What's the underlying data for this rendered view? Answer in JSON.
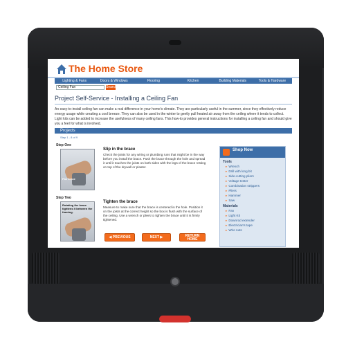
{
  "site": {
    "title": "The Home Store",
    "nav": [
      "Lighting & Fans",
      "Doors & Windows",
      "Flooring",
      "Kitchen",
      "Building Materials",
      "Tools & Hardware"
    ],
    "search_value": "Ceiling Fan",
    "search_button": "Search"
  },
  "page": {
    "title": "Project Self-Service  - Installing a Ceiling Fan",
    "intro": "An easy-to-install ceiling fan can make a real difference in your home's climate. They are particularly useful in the summer, since they effectively reduce energy usage while creating a cool breeze. They can also be used in the winter to gently pull heated air away from the ceiling where it tends to collect. Light kits can be added to increase the usefulness of many ceiling fans. This how-to provides general instructions for installing a ceiling fan and should give you a feel for what is involved.",
    "projects_label": "Projects",
    "step_count": "Step 1 - 8 of 9"
  },
  "steps": [
    {
      "label": "Step One",
      "caption": "Fan brace",
      "heading": "Slip in the brace",
      "text": "Check the joists for any wiring or plumbing runs that might be in the way before you install the brace. Push the brace through the hole and spread it until it touches the joists on both sides with the legs of the brace resting on top of the drywall or plaster."
    },
    {
      "label": "Step Two",
      "caption": "Rotating the brace tightens it between the framing.",
      "heading": "Tighten the brace",
      "text": "Measure to make sure that the brace is centered in the hole. Position it on the joists at the correct height so the box is flush with the surface of the ceiling. Use a wrench or pliers to tighten the brace until it is firmly tightened."
    }
  ],
  "buttons": {
    "previous": "PREVIOUS",
    "next": "NEXT",
    "return_home": "RETURN HOME"
  },
  "shop": {
    "title": "Shop Now",
    "tools_label": "Tools",
    "tools": [
      "Wrench",
      "Drill with long bit",
      "Side-cutting pliers",
      "Voltage tester",
      "Combination strippers",
      "Pliers",
      "Hammer",
      "Saw"
    ],
    "materials_label": "Materials",
    "materials": [
      "Fan",
      "Light Kit",
      "Downrod extender",
      "Electrician's tape",
      "Wire nuts"
    ]
  }
}
